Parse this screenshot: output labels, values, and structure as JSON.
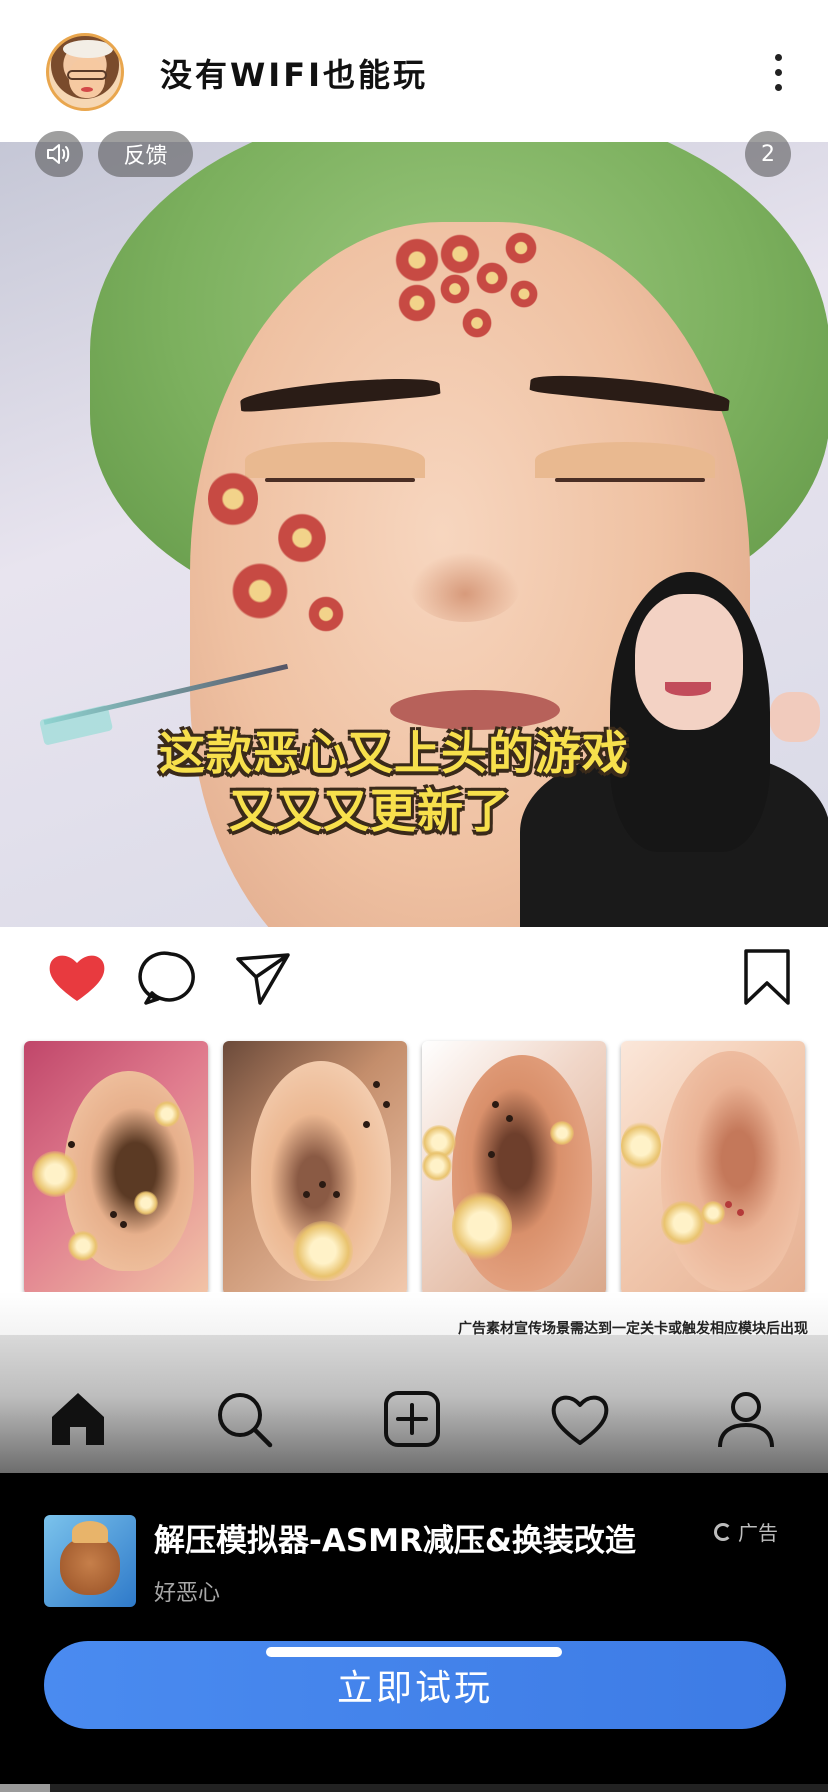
{
  "header": {
    "title": "没有WIFI也能玩"
  },
  "video": {
    "feedback_label": "反馈",
    "count_badge": "2",
    "caption_line1": "这款恶心又上头的游戏",
    "caption_line2": "又又又更新了"
  },
  "actions": {
    "icons": [
      "heart-icon",
      "comment-icon",
      "share-icon",
      "bookmark-icon"
    ],
    "like_color": "#e83a3f"
  },
  "disclaimer": "广告素材宣传场景需达到一定关卡或触发相应模块后出现",
  "bottom_nav": {
    "icons": [
      "home-icon",
      "search-icon",
      "add-icon",
      "favorites-icon",
      "profile-icon"
    ]
  },
  "ad": {
    "app_name": "解压模拟器-ASMR减压&换装改造",
    "subtitle": "好恶心",
    "label": "广告",
    "cta_label": "立即试玩",
    "cta_color": "#4387ee"
  },
  "video_progress": 0.06
}
